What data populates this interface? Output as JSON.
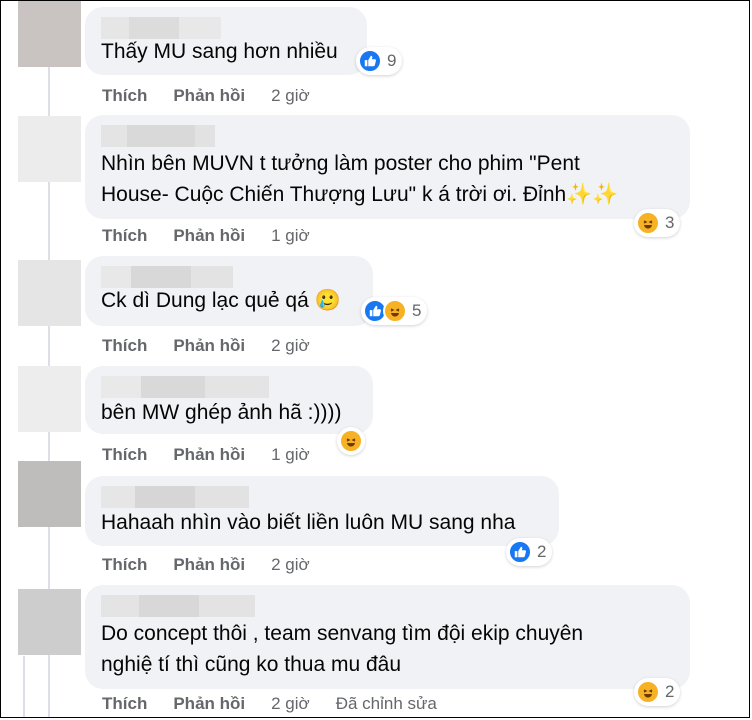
{
  "comments": [
    {
      "text": "Thấy MU sang hơn nhiều",
      "reactions": [
        "like-icon"
      ],
      "reaction_count": "9",
      "actions": {
        "like": "Thích",
        "reply": "Phản hồi",
        "time": "2 giờ"
      }
    },
    {
      "text": "Nhìn bên MUVN t tưởng làm poster cho phim \"Pent\nHouse- Cuộc Chiến Thượng Lưu\" k á trời ơi. Đỉnh✨✨",
      "reactions": [
        "haha-icon"
      ],
      "reaction_count": "3",
      "actions": {
        "like": "Thích",
        "reply": "Phản hồi",
        "time": "1 giờ"
      }
    },
    {
      "text": "Ck dì Dung lạc quẻ qá 🥲",
      "reactions": [
        "like-icon",
        "haha-icon"
      ],
      "reaction_count": "5",
      "actions": {
        "like": "Thích",
        "reply": "Phản hồi",
        "time": "2 giờ"
      }
    },
    {
      "text": "bên MW ghép ảnh hã :))))",
      "reactions": [
        "haha-icon"
      ],
      "reaction_count": "",
      "actions": {
        "like": "Thích",
        "reply": "Phản hồi",
        "time": "1 giờ"
      }
    },
    {
      "text": "Hahaah nhìn vào biết liền luôn MU sang nha",
      "reactions": [
        "like-icon"
      ],
      "reaction_count": "2",
      "actions": {
        "like": "Thích",
        "reply": "Phản hồi",
        "time": "2 giờ"
      }
    },
    {
      "text": "Do concept thôi , team senvang tìm đội ekip chuyên\nnghiệ tí thì cũng ko thua mu đâu",
      "reactions": [
        "haha-icon"
      ],
      "reaction_count": "2",
      "actions": {
        "like": "Thích",
        "reply": "Phản hồi",
        "time": "2 giờ",
        "edited": "Đã chỉnh sửa"
      }
    }
  ],
  "colors": {
    "bubble": "#f0f2f5",
    "meta": "#65676b",
    "like": "#1877f2",
    "haha": "#f7b125"
  }
}
